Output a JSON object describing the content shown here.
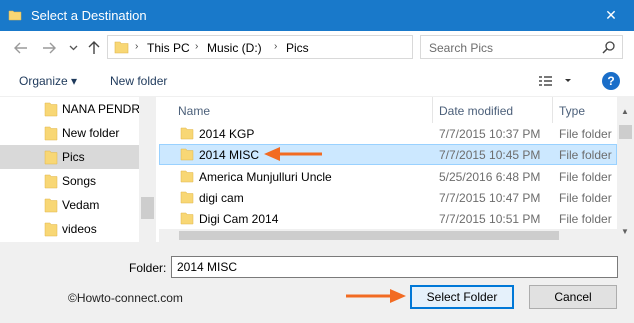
{
  "window": {
    "title": "Select a Destination",
    "close_glyph": "✕"
  },
  "address_bar": {
    "crumbs": [
      "This PC",
      "Music (D:)",
      "Pics"
    ],
    "search_placeholder": "Search Pics"
  },
  "toolbar": {
    "organize_label": "Organize ▾",
    "new_folder_label": "New folder",
    "help_label": "?"
  },
  "nav_pane": {
    "items": [
      {
        "label": "NANA PENDRIV"
      },
      {
        "label": "New folder"
      },
      {
        "label": "Pics",
        "selected": true
      },
      {
        "label": "Songs"
      },
      {
        "label": "Vedam"
      },
      {
        "label": "videos"
      }
    ]
  },
  "file_list": {
    "columns": {
      "name": "Name",
      "date": "Date modified",
      "type": "Type"
    },
    "rows": [
      {
        "name": "2014 KGP",
        "date": "7/7/2015 10:37 PM",
        "type": "File folder"
      },
      {
        "name": "2014 MISC",
        "date": "7/7/2015 10:45 PM",
        "type": "File folder",
        "selected": true
      },
      {
        "name": "America Munjulluri Uncle",
        "date": "5/25/2016 6:48 PM",
        "type": "File folder"
      },
      {
        "name": "digi cam",
        "date": "7/7/2015 10:47 PM",
        "type": "File folder"
      },
      {
        "name": "Digi Cam 2014",
        "date": "7/7/2015 10:51 PM",
        "type": "File folder"
      }
    ]
  },
  "footer": {
    "folder_label": "Folder:",
    "folder_value": "2014 MISC",
    "watermark": "©Howto-connect.com",
    "select_button": "Select Folder",
    "cancel_button": "Cancel"
  },
  "colors": {
    "titlebar": "#1979ca",
    "selection": "#cce8ff",
    "annotation_arrow": "#f26b22",
    "folder_yellow": "#f8d775"
  },
  "icons": [
    "folder-icon",
    "close-icon",
    "back-arrow-icon",
    "forward-arrow-icon",
    "chevron-down-icon",
    "up-arrow-icon",
    "refresh-icon",
    "search-icon",
    "view-options-icon",
    "help-icon"
  ]
}
